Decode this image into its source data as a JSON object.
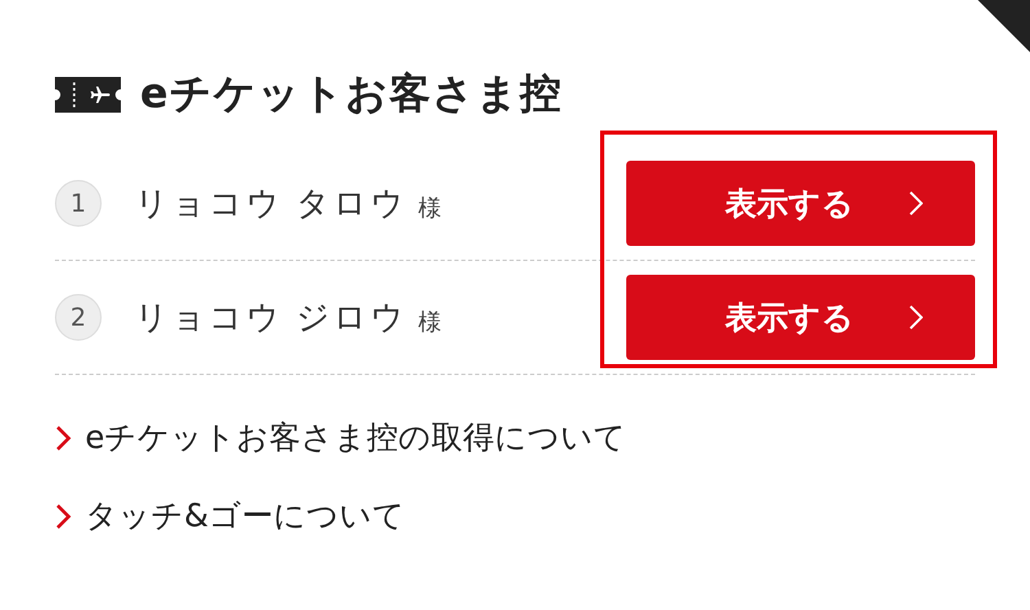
{
  "title": "eチケットお客さま控",
  "passengers": [
    {
      "number": "1",
      "name": "リョコウ タロウ",
      "honorific": "様",
      "button": "表示する"
    },
    {
      "number": "2",
      "name": "リョコウ ジロウ",
      "honorific": "様",
      "button": "表示する"
    }
  ],
  "buttons_highlighted": true,
  "links": [
    {
      "text": "eチケットお客さま控の取得について"
    },
    {
      "text": "タッチ&ゴーについて"
    }
  ]
}
